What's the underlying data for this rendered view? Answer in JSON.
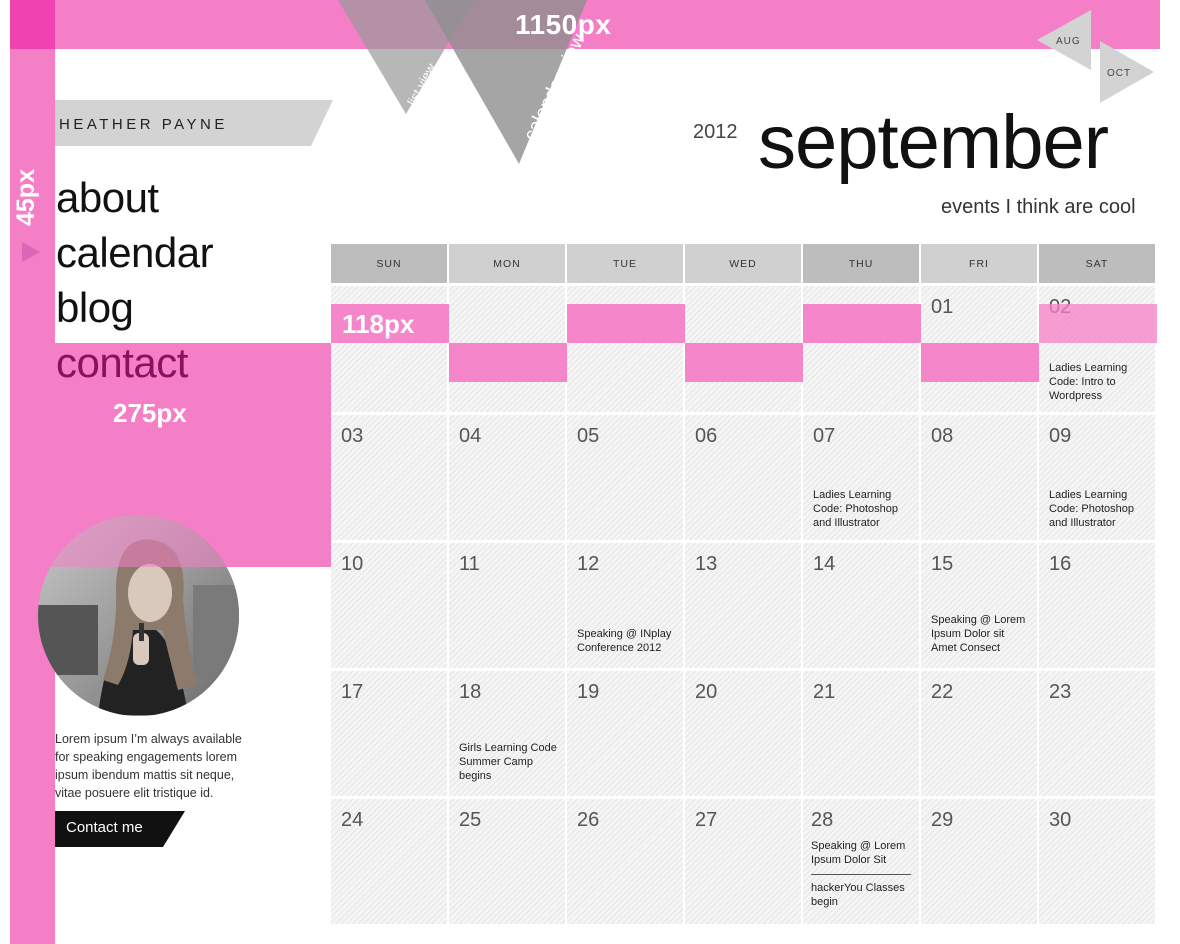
{
  "overlay": {
    "top_label": "1150px",
    "left_label": "45px",
    "row_label": "118px",
    "col_label": "275px",
    "colors": {
      "pink": "#f57fc7",
      "pink_dark": "#f043b0",
      "accent": "#8a1060"
    }
  },
  "views": {
    "list": "list view",
    "calendar": "calendar view"
  },
  "brand": {
    "name": "HEATHER PAYNE"
  },
  "nav": {
    "items": [
      {
        "label": "about"
      },
      {
        "label": "calendar"
      },
      {
        "label": "blog"
      },
      {
        "label": "contact"
      }
    ],
    "active_index": 1
  },
  "profile": {
    "image_icon": "portrait-photo",
    "bio": "Lorem ipsum I’m always available for speaking engagements lorem ipsum ibendum mattis sit neque, vitae posuere elit tristique id.",
    "contact_button": "Contact me"
  },
  "header": {
    "year": "2012",
    "month": "september",
    "tagline": "events I think are cool",
    "prev_month": "AUG",
    "next_month": "OCT"
  },
  "calendar": {
    "days_of_week": [
      "SUN",
      "MON",
      "TUE",
      "WED",
      "THU",
      "FRI",
      "SAT"
    ],
    "weeks": [
      [
        {
          "day": "",
          "events": []
        },
        {
          "day": "",
          "events": []
        },
        {
          "day": "",
          "events": []
        },
        {
          "day": "",
          "events": []
        },
        {
          "day": "",
          "events": []
        },
        {
          "day": "01",
          "events": []
        },
        {
          "day": "02",
          "events": [
            "Ladies Learning Code: Intro to Wordpress"
          ]
        }
      ],
      [
        {
          "day": "03",
          "events": []
        },
        {
          "day": "04",
          "events": []
        },
        {
          "day": "05",
          "events": []
        },
        {
          "day": "06",
          "events": []
        },
        {
          "day": "07",
          "events": [
            "Ladies Learning Code: Photoshop and Illustrator"
          ]
        },
        {
          "day": "08",
          "events": []
        },
        {
          "day": "09",
          "events": [
            "Ladies Learning Code: Photoshop and Illustrator"
          ]
        }
      ],
      [
        {
          "day": "10",
          "events": []
        },
        {
          "day": "11",
          "events": []
        },
        {
          "day": "12",
          "events": [
            "Speaking @ INplay Conference 2012"
          ]
        },
        {
          "day": "13",
          "events": []
        },
        {
          "day": "14",
          "events": []
        },
        {
          "day": "15",
          "events": [
            "Speaking @ Lorem Ipsum Dolor sit Amet Consect"
          ]
        },
        {
          "day": "16",
          "events": []
        }
      ],
      [
        {
          "day": "17",
          "events": []
        },
        {
          "day": "18",
          "events": [
            "Girls Learning Code Summer Camp begins"
          ]
        },
        {
          "day": "19",
          "events": []
        },
        {
          "day": "20",
          "events": []
        },
        {
          "day": "21",
          "events": []
        },
        {
          "day": "22",
          "events": []
        },
        {
          "day": "23",
          "events": []
        }
      ],
      [
        {
          "day": "24",
          "events": []
        },
        {
          "day": "25",
          "events": []
        },
        {
          "day": "26",
          "events": []
        },
        {
          "day": "27",
          "events": []
        },
        {
          "day": "28",
          "events": [
            "Speaking @ Lorem Ipsum Dolor Sit",
            "hackerYou Classes begin"
          ]
        },
        {
          "day": "29",
          "events": []
        },
        {
          "day": "30",
          "events": []
        }
      ]
    ]
  }
}
